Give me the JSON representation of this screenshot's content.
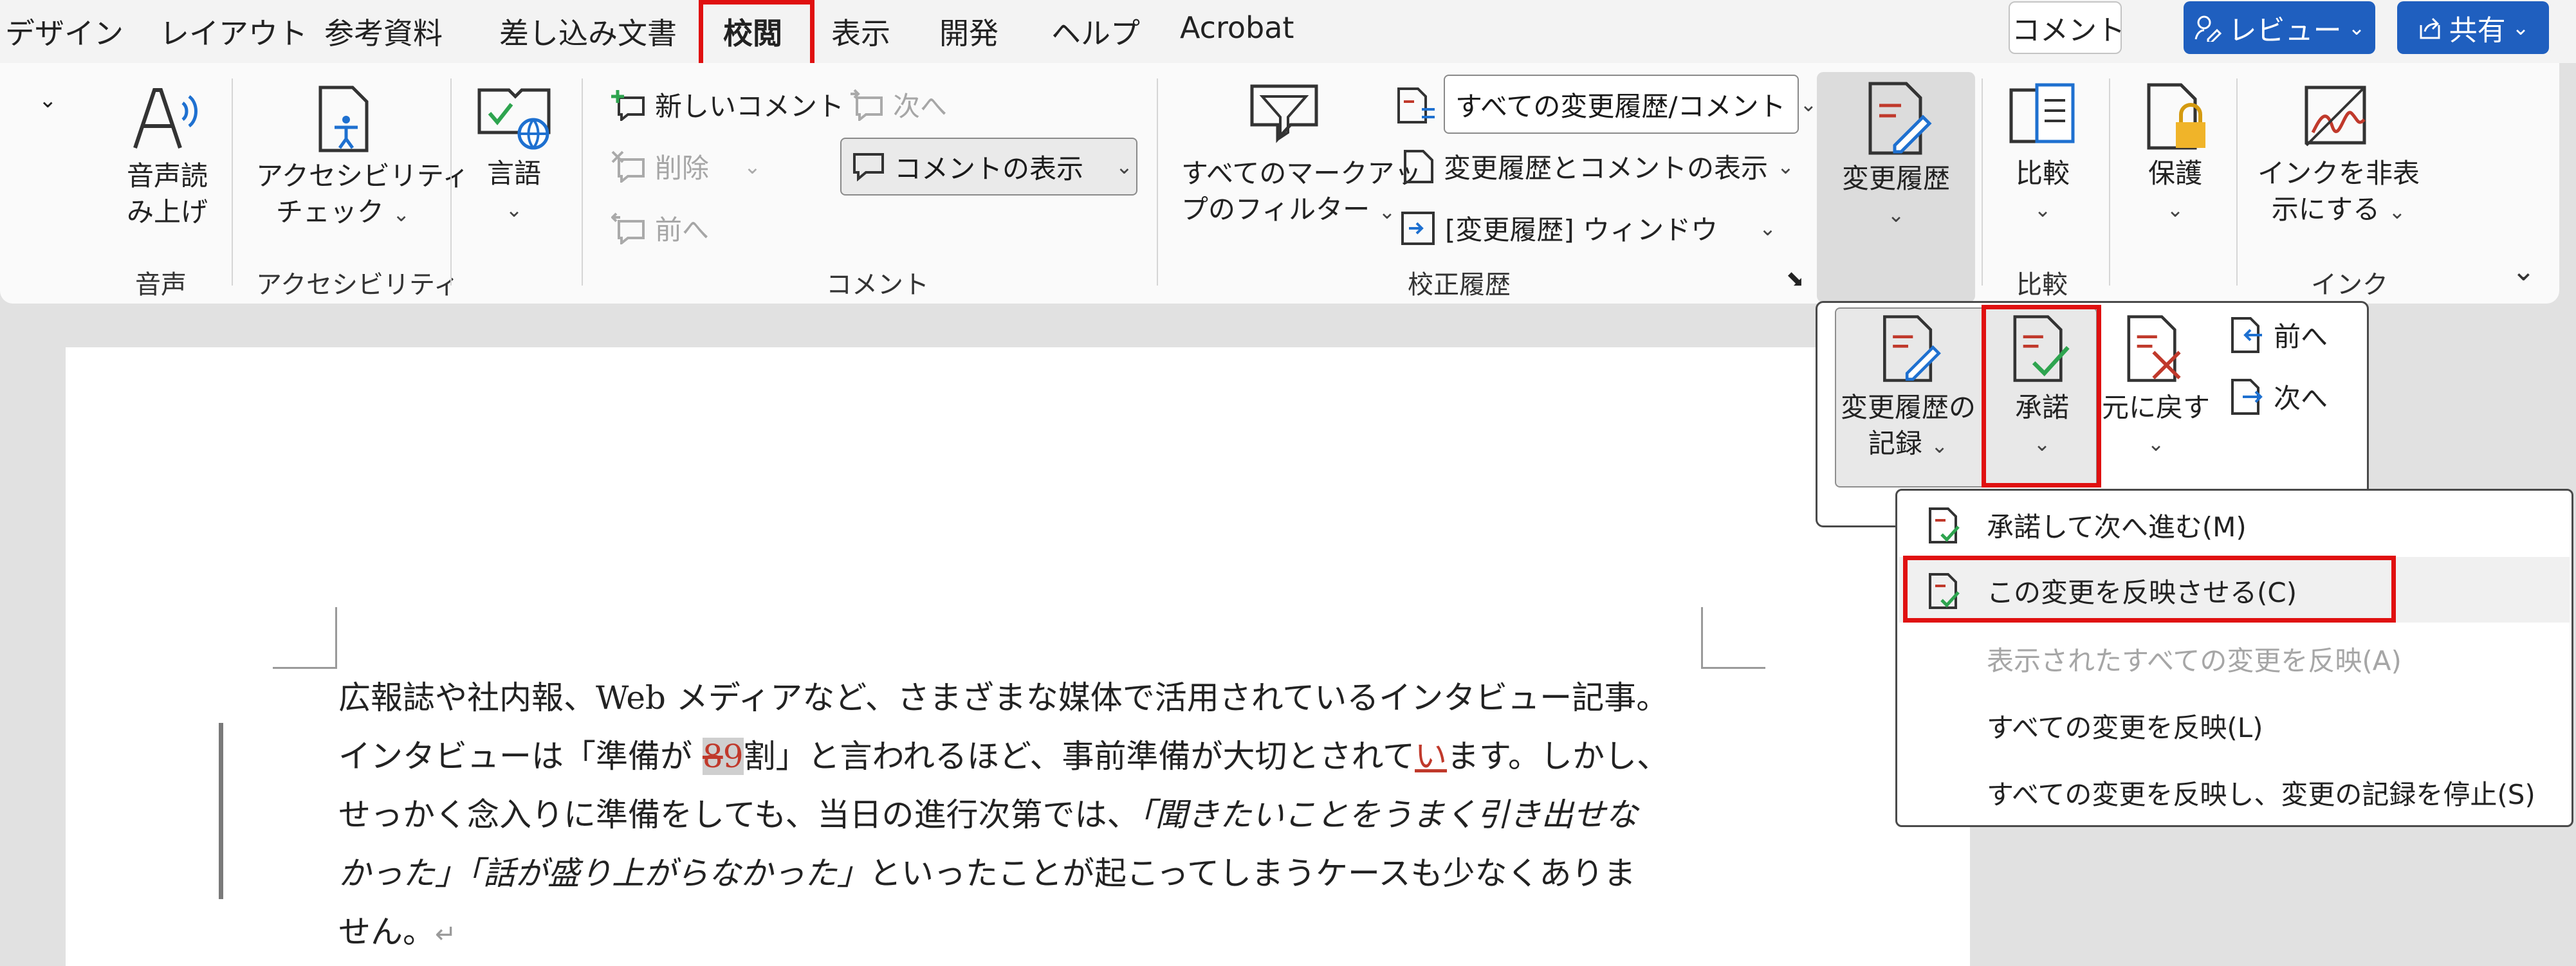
{
  "tabs": [
    "デザイン",
    "レイアウト",
    "参考資料",
    "差し込み文書",
    "校閲",
    "表示",
    "開発",
    "ヘルプ",
    "Acrobat"
  ],
  "header": {
    "comment": "コメント",
    "review": "レビュー",
    "share": "共有"
  },
  "speech": {
    "label1": "音声読",
    "label2": "み上げ",
    "group": "音声"
  },
  "access": {
    "label1": "アクセシビリティ",
    "label2": "チェック",
    "group": "アクセシビリティ"
  },
  "language": {
    "label": "言語"
  },
  "comments": {
    "new": "新しいコメント",
    "delete": "削除",
    "prev": "前へ",
    "next": "次へ",
    "show": "コメントの表示",
    "group": "コメント"
  },
  "markup_filter": {
    "label1": "すべてのマークアッ",
    "label2": "プのフィルター"
  },
  "tracking": {
    "display_select": "すべての変更履歴/コメント",
    "show_markup": "変更履歴とコメントの表示",
    "pane": "[変更履歴] ウィンドウ",
    "group": "校正履歴"
  },
  "track_changes": {
    "label": "変更履歴"
  },
  "compare": {
    "label": "比較",
    "group": "比較"
  },
  "protect": {
    "label": "保護"
  },
  "ink": {
    "label1": "インクを非表",
    "label2": "示にする",
    "group": "インク"
  },
  "flyout": {
    "record1": "変更履歴の",
    "record2": "記録",
    "accept": "承諾",
    "reject": "元に戻す",
    "prev": "前へ",
    "next": "次へ"
  },
  "menu": {
    "items": [
      "承諾して次へ進む(M)",
      "この変更を反映させる(C)",
      "表示されたすべての変更を反映(A)",
      "すべての変更を反映(L)",
      "すべての変更を反映し、変更の記録を停止(S)"
    ]
  },
  "document": {
    "line1": "広報誌や社内報、Web メディアなど、さまざまな媒体で活用されているインタビュー記事。",
    "line2a": "インタビューは「準備が ",
    "line2_del": "8",
    "line2_ins": "9",
    "line2b": "割」と言われるほど、事前準備が大切とされて",
    "line2_ins2": "い",
    "line2c": "ます。しかし、",
    "line3a": "せっかく念入りに準備をしても、当日の進行次第では、",
    "line3_it": "「聞きたいことをうまく引き出せな",
    "line4_it1": "かった」「話が盛り上がらなかった」",
    "line4b": "といったことが起こってしまうケースも少なくありま",
    "line5": "せん。",
    "para_mark": "↵"
  }
}
